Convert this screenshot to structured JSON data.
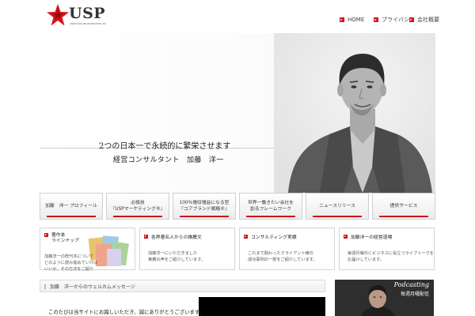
{
  "logo": {
    "name": "USP",
    "subtitle": "UNIQUE SELLING PROPOSITION, INC."
  },
  "topnav": [
    {
      "label": "HOME",
      "icon": "red-arrow-square-icon"
    },
    {
      "label": "プライバシー",
      "icon": "red-arrow-square-icon"
    },
    {
      "label": "会社概要",
      "icon": "red-arrow-square-icon"
    }
  ],
  "hero": {
    "headline": "2つの日本一で永続的に繁栄させます",
    "subline": "経営コンサルタント　加藤　洋一"
  },
  "nav_buttons": [
    {
      "line1": "加藤　洋一 プロフィール",
      "line2": ""
    },
    {
      "line1": "必殺技",
      "line2": "『USPマーケティング®』"
    },
    {
      "line1": "100%増収増益になる型",
      "line2": "『コアブランド戦略®』"
    },
    {
      "line1": "世界一働きたい会社を",
      "line2": "創るフレームワーク"
    },
    {
      "line1": "ニュースリリース",
      "line2": ""
    },
    {
      "line1": "提供サービス",
      "line2": ""
    }
  ],
  "features": [
    {
      "title_line1": "著作本",
      "title_line2": "ラインナップ",
      "body_line1": "加藤洋一の既刊本について",
      "body_line2": "どのように読み進めていけば",
      "body_line3": "いいか、その方法をご紹介"
    },
    {
      "title": "各界著名人からの推薦文",
      "body_line1": "加藤洋一にいただきました",
      "body_line2": "推薦の声をご紹介しています。"
    },
    {
      "title": "コンサルティング実績",
      "body_line1": "これまで関わったクライアント様の",
      "body_line2": "成功事例の一部をご紹介しています。"
    },
    {
      "title": "加藤洋一の経営道場",
      "body_line1": "毎週月曜日にビジネスに役立つライブトークを",
      "body_line2": "お届けしています。"
    }
  ],
  "welcome": {
    "title": "加藤　洋一からのウェルカムメッセージ",
    "text": "このたびは当サイトにお越しいただき、誠にありがとうございます。"
  },
  "podcast": {
    "title": "Podcasting",
    "subtitle": "毎週月曜配信"
  },
  "colors": {
    "accent_red": "#c8161d",
    "text_dark": "#222222",
    "border_gray": "#cfcfcf"
  }
}
